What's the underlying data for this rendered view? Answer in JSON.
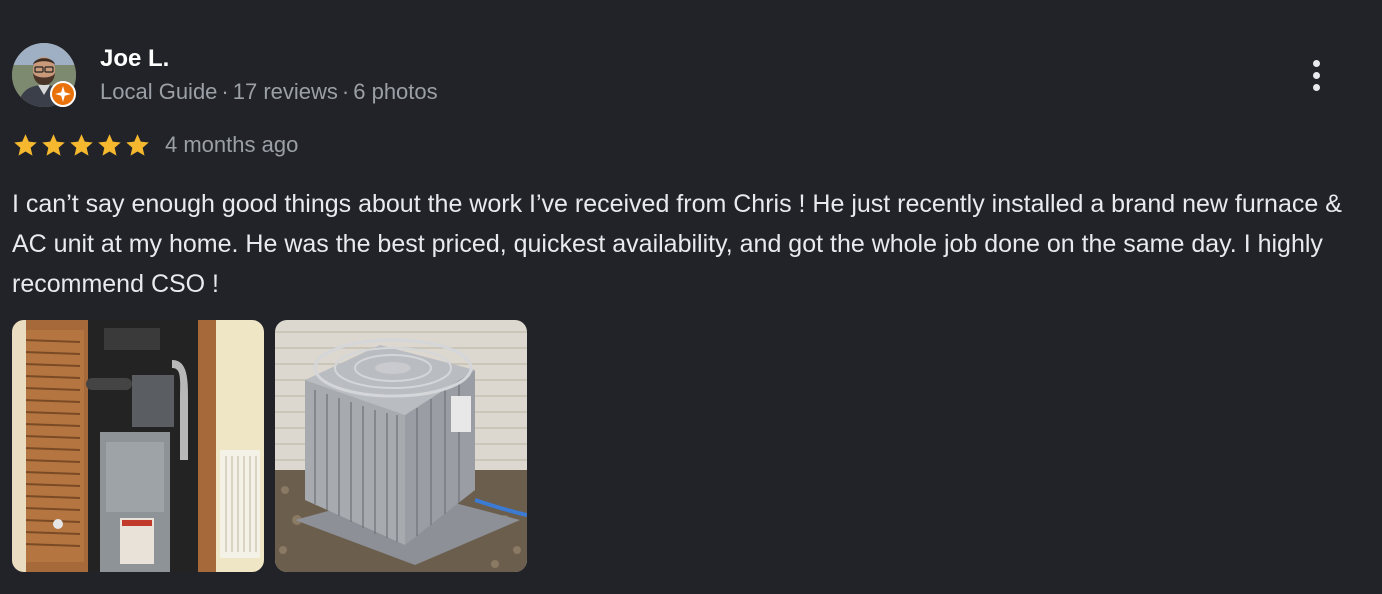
{
  "author": {
    "name": "Joe L.",
    "badge": "Local Guide",
    "reviews": "17 reviews",
    "photos": "6 photos",
    "separator": "·",
    "avatar_icon": "person-avatar",
    "badge_icon": "local-guide-star-icon",
    "badge_color": "#e8710a"
  },
  "rating": {
    "stars": 5,
    "max": 5,
    "star_color": "#f5b82e",
    "date": "4 months ago"
  },
  "review": {
    "text": "I can’t say enough good things about the work I’ve received from Chris ! He just recently installed a brand new furnace & AC unit at my home. He was the best priced, quickest availability, and got the whole job done on the same day. I highly recommend CSO !"
  },
  "photos": [
    {
      "subject": "furnace-photo"
    },
    {
      "subject": "ac-condenser-photo"
    }
  ],
  "actions": {
    "more_icon": "more-vert-icon"
  }
}
